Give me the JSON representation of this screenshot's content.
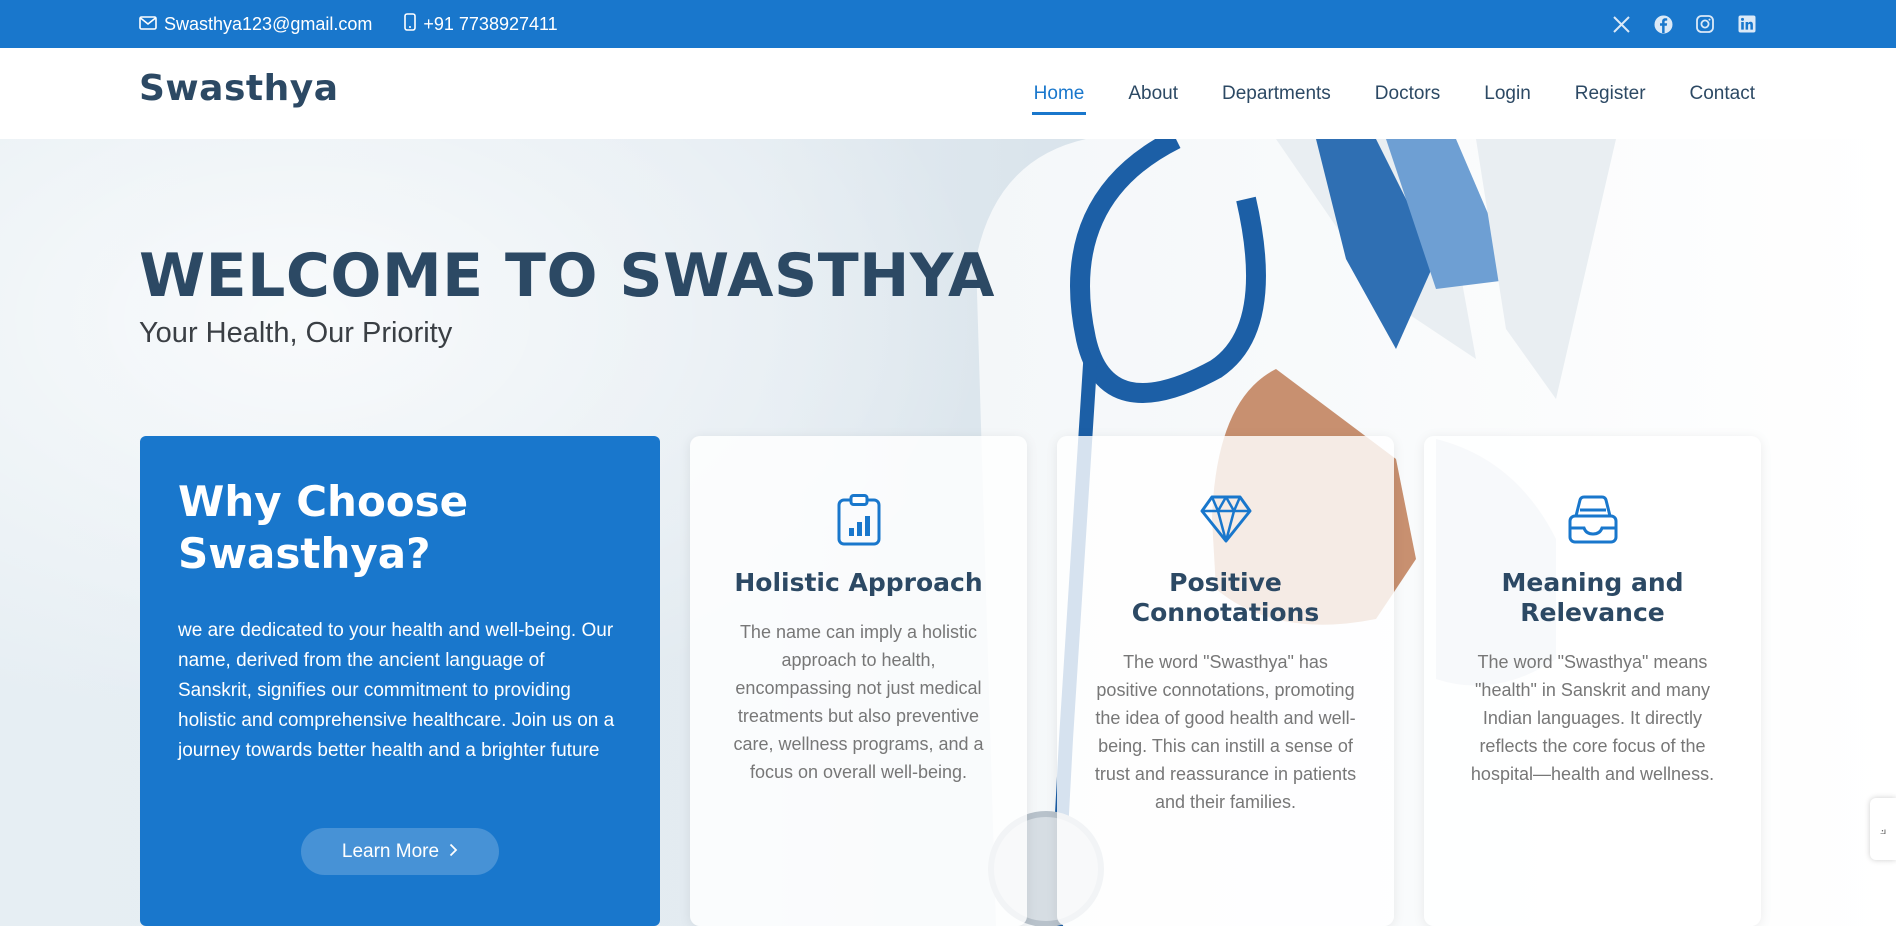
{
  "topbar": {
    "email": "Swasthya123@gmail.com",
    "phone": "+91 7738927411",
    "social": [
      "x-icon",
      "facebook-icon",
      "instagram-icon",
      "linkedin-icon"
    ]
  },
  "header": {
    "logo": "Swasthya",
    "nav": [
      "Home",
      "About",
      "Departments",
      "Doctors",
      "Login",
      "Register",
      "Contact"
    ],
    "active_nav": "Home"
  },
  "hero": {
    "title": "WELCOME TO SWASTHYA",
    "subtitle": "Your Health, Our Priority"
  },
  "why": {
    "title": "Why Choose Swasthya?",
    "text": "we are dedicated to your health and well-being. Our name, derived from the ancient language of Sanskrit, signifies our commitment to providing holistic and comprehensive healthcare. Join us on a journey towards better health and a brighter future",
    "button": "Learn More"
  },
  "cards": [
    {
      "icon": "clipboard-chart-icon",
      "title": "Holistic Approach",
      "text": "The name can imply a holistic approach to health, encompassing not just medical treatments but also preventive care, wellness programs, and a focus on overall well-being."
    },
    {
      "icon": "gem-icon",
      "title": "Positive Connotations",
      "text": "The word \"Swasthya\" has positive connotations, promoting the idea of good health and well-being. This can instill a sense of trust and reassurance in patients and their families."
    },
    {
      "icon": "inbox-icon",
      "title": "Meaning and Relevance",
      "text": "The word \"Swasthya\" means \"health\" in Sanskrit and many Indian languages. It directly reflects the core focus of the hospital—health and wellness."
    }
  ],
  "colors": {
    "primary": "#1977cc",
    "heading": "#2c4964",
    "muted": "#777777"
  }
}
